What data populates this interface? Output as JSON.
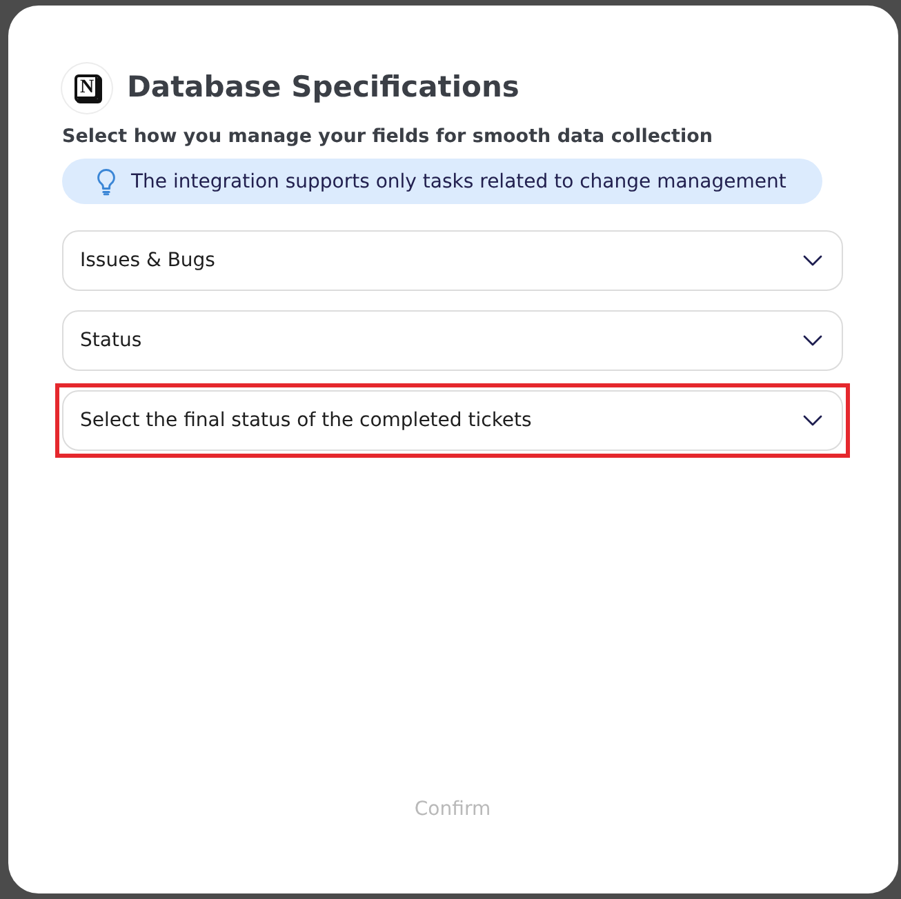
{
  "header": {
    "logo_letter": "N",
    "title": "Database Specifications",
    "subtitle": "Select how you manage your fields for smooth data collection"
  },
  "notice": {
    "text": "The integration supports only tasks related to change management"
  },
  "dropdowns": [
    {
      "value": "Issues & Bugs",
      "highlighted": false
    },
    {
      "value": "Status",
      "highlighted": false
    },
    {
      "value": "Select the final status of the completed tickets",
      "highlighted": true
    }
  ],
  "confirm_button": {
    "label": "Confirm",
    "disabled": true
  }
}
